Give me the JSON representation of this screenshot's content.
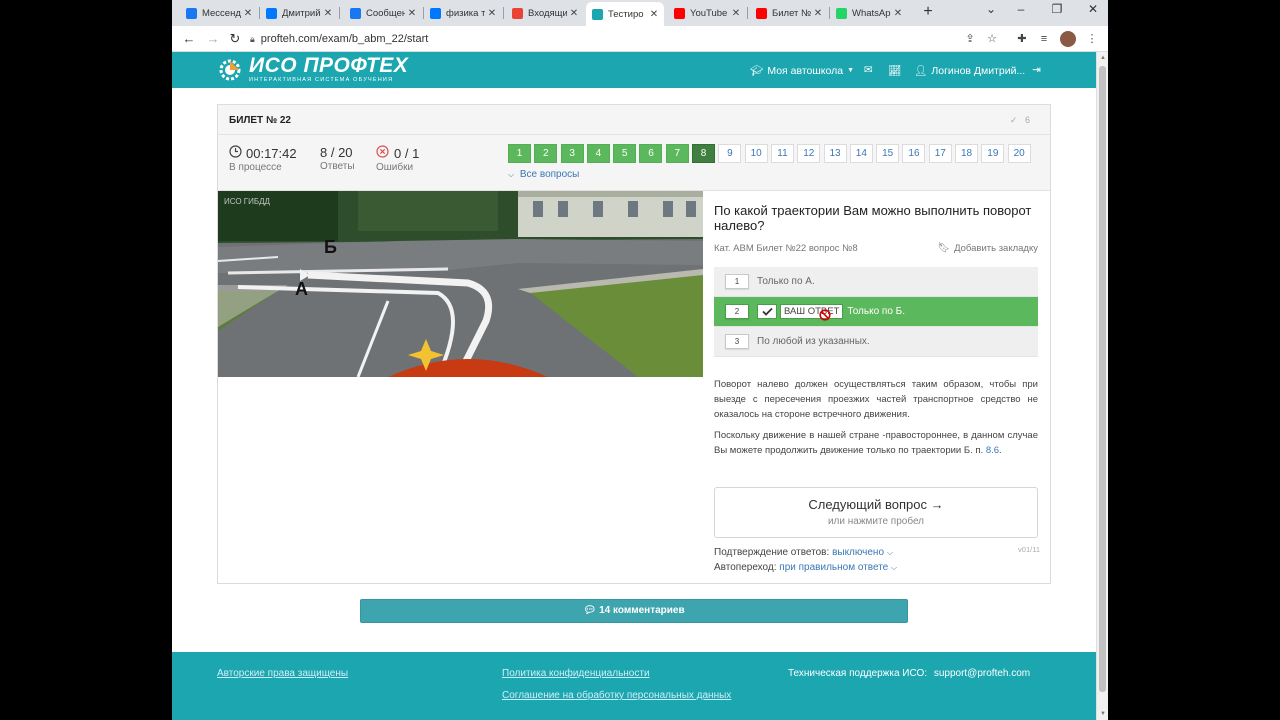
{
  "browser": {
    "tabs": [
      {
        "label": "Мессендж",
        "icon": "messenger-icon",
        "color": "#1877f2"
      },
      {
        "label": "Дмитрий",
        "icon": "vk-icon",
        "color": "#0077ff"
      },
      {
        "label": "Сообщени",
        "icon": "messenger-icon",
        "color": "#1877f2"
      },
      {
        "label": "физика т",
        "icon": "vk-icon",
        "color": "#0077ff"
      },
      {
        "label": "Входящи",
        "icon": "gmail-icon",
        "color": "#ea4335"
      },
      {
        "label": "Тестиро",
        "icon": "profteh-favicon-icon",
        "color": "#1ba6b0",
        "active": true
      },
      {
        "label": "YouTube",
        "icon": "youtube-icon",
        "color": "#ff0000"
      },
      {
        "label": "Билет №",
        "icon": "youtube-icon",
        "color": "#ff0000"
      },
      {
        "label": "WhatsApp",
        "icon": "whatsapp-icon",
        "color": "#25d366"
      }
    ],
    "url": "profteh.com/exam/b_abm_22/start"
  },
  "header": {
    "logo_title": "ИСО ПРОФТЕХ",
    "logo_subtitle": "ИНТЕРАКТИВНАЯ СИСТЕМА ОБУЧЕНИЯ",
    "school": "Моя автошкола",
    "user": "Логинов Дмитрий..."
  },
  "ticket": {
    "title": "БИЛЕТ № 22",
    "check_count": "6",
    "timer": "00:17:42",
    "timer_label": "В процессе",
    "answers_value": "8 / 20",
    "answers_label": "Ответы",
    "errors_value": "0 / 1",
    "errors_label": "Ошибки",
    "all_questions": "Все вопросы",
    "questions": [
      "1",
      "2",
      "3",
      "4",
      "5",
      "6",
      "7",
      "8",
      "9",
      "10",
      "11",
      "12",
      "13",
      "14",
      "15",
      "16",
      "17",
      "18",
      "19",
      "20"
    ],
    "completed_count": 7,
    "current_index": 7
  },
  "scene": {
    "watermark": "ИСО ГИБДД",
    "label_a": "А",
    "label_b": "Б"
  },
  "question": {
    "text": "По какой траектории Вам можно выполнить поворот налево?",
    "meta": "Кат. ABM   Билет №22   вопрос №8",
    "bookmark": "Добавить закладку",
    "answers": [
      {
        "num": "1",
        "text": "Только по А."
      },
      {
        "num": "2",
        "text": "Только по Б.",
        "tag": "ВАШ ОТВЕТ"
      },
      {
        "num": "3",
        "text": "По любой из указанных."
      }
    ],
    "explanation_1": "Поворот налево должен осуществляться таким образом, чтобы при выезде с пересечения проезжих частей транспортное средство не оказалось на стороне встречного движения.",
    "explanation_2": "Поскольку движение в нашей стране -правостороннее, в данном случае Вы можете продолжить движение только по траектории Б. п. ",
    "explanation_link": "8.6",
    "next_title": "Следующий вопрос",
    "next_hint": "или нажмите пробел",
    "version": "v01/11",
    "confirm_label": "Подтверждение ответов:",
    "confirm_value": "выключено",
    "autonext_label": "Автопереход:",
    "autonext_value": "при правильном ответе"
  },
  "comments": "14 комментариев",
  "footer": {
    "copyright": "Авторские права защищены",
    "privacy": "Политика конфиденциальности",
    "agreement": "Соглашение на обработку персональных данных",
    "support_label": "Техническая поддержка ИСО:",
    "support_email": "support@profteh.com"
  }
}
